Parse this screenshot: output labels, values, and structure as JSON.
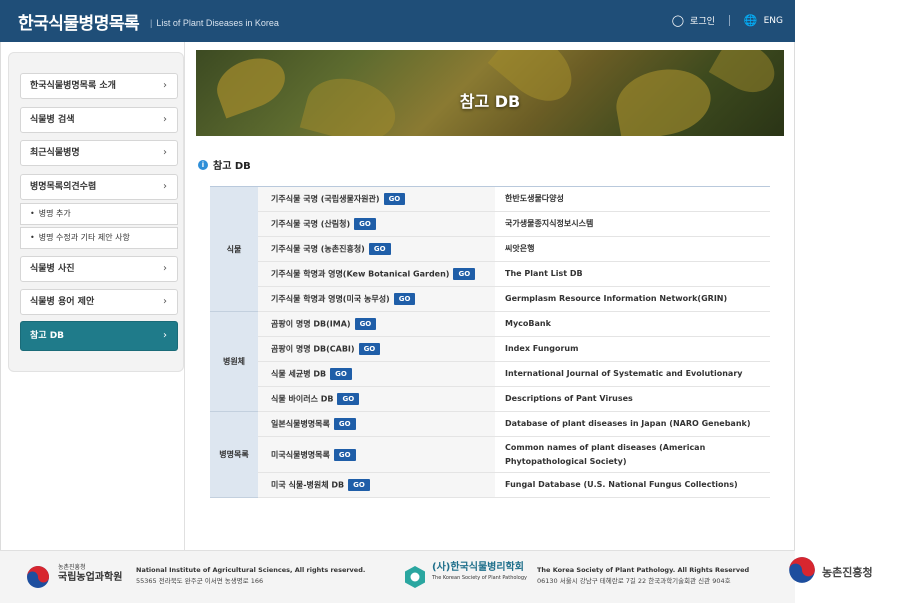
{
  "header": {
    "title": "한국식물병명목록",
    "subtitle": "List of Plant Diseases in Korea",
    "login_label": "로그인",
    "lang_label": "ENG"
  },
  "sidebar": {
    "items": [
      {
        "label": "한국식물병명목록 소개"
      },
      {
        "label": "식물병 검색"
      },
      {
        "label": "최근식물병명"
      },
      {
        "label": "병명목록의견수렴"
      },
      {
        "label": "식물병 사진"
      },
      {
        "label": "식물병 용어 제안"
      },
      {
        "label": "참고 DB"
      }
    ],
    "subitems": [
      {
        "label": "병명 추가"
      },
      {
        "label": "병명 수정과 기타 제안 사항"
      }
    ]
  },
  "banner": {
    "title": "참고 DB"
  },
  "section": {
    "title": "참고 DB"
  },
  "go_label": "GO",
  "table": {
    "groups": [
      {
        "category": "식물",
        "rows": [
          {
            "name": "기주식물 국명 (국립생물자원관)",
            "desc": "한반도생물다양성"
          },
          {
            "name": "기주식물 국명 (산림청)",
            "desc": "국가생물종지식정보시스템"
          },
          {
            "name": "기주식물 국명 (농촌진흥청)",
            "desc": "씨앗은행"
          },
          {
            "name": "기주식물 학명과 영명(Kew Botanical Garden)",
            "desc": "The Plant List DB"
          },
          {
            "name": "기주식물 학명과 영명(미국 농무성)",
            "desc": "Germplasm Resource Information Network(GRIN)"
          }
        ]
      },
      {
        "category": "병원체",
        "rows": [
          {
            "name": "곰팡이 명명 DB(IMA)",
            "desc": "MycoBank"
          },
          {
            "name": "곰팡이 명명 DB(CABI)",
            "desc": "Index Fungorum"
          },
          {
            "name": "식물 세균병 DB",
            "desc": "International Journal of Systematic and Evolutionary"
          },
          {
            "name": "식물 바이러스 DB",
            "desc": "Descriptions of Pant Viruses"
          }
        ]
      },
      {
        "category": "병명목록",
        "rows": [
          {
            "name": "일본식물병명목록",
            "desc": "Database of plant diseases in Japan (NARO Genebank)"
          },
          {
            "name": "미국식물병명목록",
            "desc": "Common names of plant diseases (American Phytopathological Society)"
          },
          {
            "name": "미국 식물-병원체 DB",
            "desc": "Fungal Database (U.S. National Fungus Collections)"
          }
        ]
      }
    ]
  },
  "footer": {
    "org1_small": "농촌진흥청",
    "org1_name": "국립농업과학원",
    "org1_line1": "National Institute of Agricultural Sciences, All rights reserved.",
    "org1_line2": "55365 전라북도 완주군 이서면 농생명로 166",
    "org2_name": "(사)한국식물병리학회",
    "org2_sub": "The Korean Society of Plant Pathology",
    "org2_line1": "The Korea Society of Plant Pathology. All Rights Reserved",
    "org2_line2": "06130 서울시 강남구 테헤란로 7길 22 한국과학기술회관 신관 904호",
    "rda_name": "농촌진흥청"
  }
}
